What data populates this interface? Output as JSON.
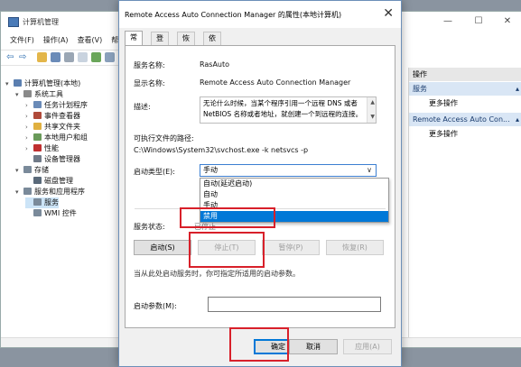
{
  "mmc": {
    "title": "计算机管理",
    "menu": [
      "文件(F)",
      "操作(A)",
      "查看(V)",
      "帮"
    ],
    "window_buttons": [
      "—",
      "☐",
      "✕"
    ],
    "tree": [
      {
        "label": "计算机管理(本地)",
        "icon": "computer-icon",
        "icon_color": "#5b7fb0",
        "level": 0,
        "arrow": "▾",
        "selected": false
      },
      {
        "label": "系统工具",
        "icon": "tools-icon",
        "icon_color": "#8a8a8a",
        "level": 1,
        "arrow": "▾",
        "selected": false
      },
      {
        "label": "任务计划程序",
        "icon": "clock-icon",
        "icon_color": "#6a8bb8",
        "level": 2,
        "arrow": "›",
        "selected": false
      },
      {
        "label": "事件查看器",
        "icon": "event-icon",
        "icon_color": "#b04a3a",
        "level": 2,
        "arrow": "›",
        "selected": false
      },
      {
        "label": "共享文件夹",
        "icon": "folder-icon",
        "icon_color": "#e0b040",
        "level": 2,
        "arrow": "›",
        "selected": false
      },
      {
        "label": "本地用户和组",
        "icon": "users-icon",
        "icon_color": "#6a9a5a",
        "level": 2,
        "arrow": "›",
        "selected": false
      },
      {
        "label": "性能",
        "icon": "performance-icon",
        "icon_color": "#c03030",
        "level": 2,
        "arrow": "›",
        "selected": false
      },
      {
        "label": "设备管理器",
        "icon": "device-icon",
        "icon_color": "#707a88",
        "level": 2,
        "arrow": "",
        "selected": false
      },
      {
        "label": "存储",
        "icon": "storage-icon",
        "icon_color": "#7a8a9a",
        "level": 1,
        "arrow": "▾",
        "selected": false
      },
      {
        "label": "磁盘管理",
        "icon": "disk-icon",
        "icon_color": "#5a6a7a",
        "level": 2,
        "arrow": "",
        "selected": false
      },
      {
        "label": "服务和应用程序",
        "icon": "services-apps-icon",
        "icon_color": "#7a8a9a",
        "level": 1,
        "arrow": "▾",
        "selected": false
      },
      {
        "label": "服务",
        "icon": "services-icon",
        "icon_color": "#7a8a9a",
        "level": 2,
        "arrow": "",
        "selected": true
      },
      {
        "label": "WMI 控件",
        "icon": "wmi-icon",
        "icon_color": "#7a8a9a",
        "level": 2,
        "arrow": "",
        "selected": false
      }
    ],
    "actions": {
      "header": "操作",
      "section1": "服务",
      "item1": "更多操作",
      "section2": "Remote Access Auto Con...",
      "item2": "更多操作"
    }
  },
  "dialog": {
    "title": "Remote Access Auto Connection Manager 的属性(本地计算机)",
    "close": "✕",
    "tabs": [
      "常规",
      "登录",
      "恢复",
      "依存关系"
    ],
    "service_name_label": "服务名称:",
    "service_name": "RasAuto",
    "display_name_label": "显示名称:",
    "display_name": "Remote Access Auto Connection Manager",
    "description_label": "描述:",
    "description": "无论什么时候，当某个程序引用一个远程 DNS 或者 NetBIOS 名称或者地址，就创建一个到远程的连接。",
    "path_label": "可执行文件的路径:",
    "path": "C:\\Windows\\System32\\svchost.exe -k netsvcs -p",
    "startup_type_label": "启动类型(E):",
    "startup_type_value": "手动",
    "startup_options": [
      "自动(延迟启动)",
      "自动",
      "手动",
      "禁用"
    ],
    "startup_highlighted": "禁用",
    "service_status_label": "服务状态:",
    "service_status_value": "已停止",
    "buttons": {
      "start": "启动(S)",
      "stop": "停止(T)",
      "pause": "暂停(P)",
      "resume": "恢复(R)"
    },
    "hint": "当从此处启动服务时，你可指定所适用的启动参数。",
    "start_params_label": "启动参数(M):",
    "start_params_value": "",
    "ok": "确定",
    "cancel": "取消",
    "apply": "应用(A)"
  },
  "colors": {
    "accent": "#0078d7",
    "highlight_box": "#d8202a"
  }
}
